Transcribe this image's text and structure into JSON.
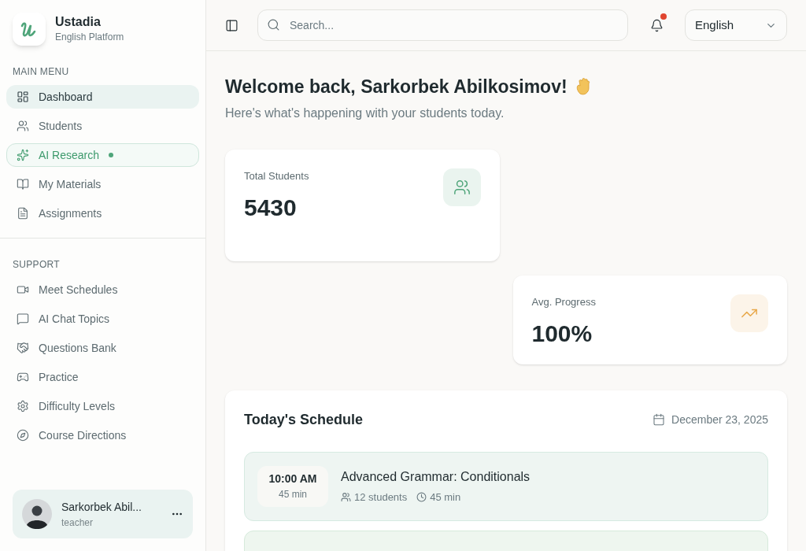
{
  "brand": {
    "name": "Ustadia",
    "subtitle": "English Platform"
  },
  "sidebar": {
    "sections": [
      {
        "heading": "MAIN MENU",
        "items": [
          {
            "label": "Dashboard",
            "selected": true,
            "highlighted": false,
            "dot": false
          },
          {
            "label": "Students",
            "selected": false,
            "highlighted": false,
            "dot": false
          },
          {
            "label": "AI Research",
            "selected": false,
            "highlighted": true,
            "dot": true
          },
          {
            "label": "My Materials",
            "selected": false,
            "highlighted": false,
            "dot": false
          },
          {
            "label": "Assignments",
            "selected": false,
            "highlighted": false,
            "dot": false
          }
        ]
      },
      {
        "heading": "SUPPORT",
        "items": [
          {
            "label": "Meet Schedules",
            "selected": false,
            "highlighted": false,
            "dot": false
          },
          {
            "label": "AI Chat Topics",
            "selected": false,
            "highlighted": false,
            "dot": false
          },
          {
            "label": "Questions Bank",
            "selected": false,
            "highlighted": false,
            "dot": false
          },
          {
            "label": "Practice",
            "selected": false,
            "highlighted": false,
            "dot": false
          },
          {
            "label": "Difficulty Levels",
            "selected": false,
            "highlighted": false,
            "dot": false
          },
          {
            "label": "Course Directions",
            "selected": false,
            "highlighted": false,
            "dot": false
          }
        ]
      }
    ]
  },
  "user": {
    "name": "Sarkorbek Abil...",
    "role": "teacher"
  },
  "header": {
    "search": {
      "placeholder": "Search..."
    },
    "notifications": {
      "unread": true
    },
    "language": {
      "value": "English"
    }
  },
  "welcome": {
    "title": "Welcome back, Sarkorbek Abilkosimov!",
    "subtitle": "Here's what's happening with your students today."
  },
  "stats": [
    {
      "label": "Total Students",
      "value": "5430",
      "color": "#4fa57a"
    },
    {
      "label": "Avg. Progress",
      "value": "100%",
      "color": "#e8a84a"
    }
  ],
  "schedule": {
    "title": "Today's Schedule",
    "date": "December 23, 2025",
    "items": [
      {
        "time": "10:00 AM",
        "duration": "45 min",
        "title": "Advanced Grammar: Conditionals",
        "students": "12 students",
        "length": "45 min"
      }
    ]
  }
}
